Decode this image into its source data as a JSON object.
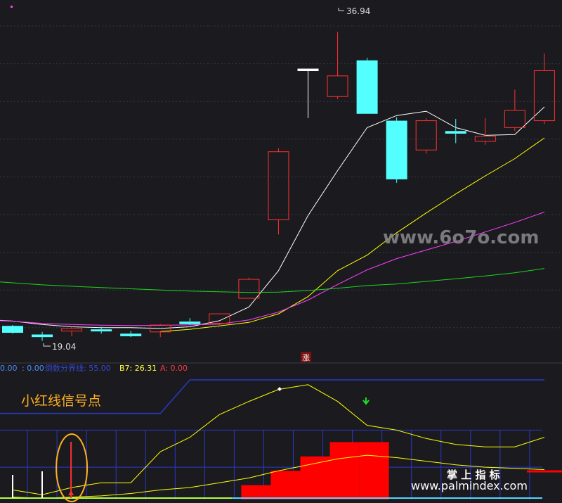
{
  "chart_data": [
    {
      "type": "candlestick",
      "panel": "main",
      "price_range": [
        18.4,
        38.8
      ],
      "annotations": {
        "high_label": "36.94",
        "low_label": "19.04",
        "zhang_badge": "涨"
      },
      "watermark": "www.6o7o.com",
      "candles": [
        {
          "open": 19.9,
          "close": 19.5,
          "high": 19.95,
          "low": 19.45
        },
        {
          "open": 19.4,
          "close": 19.25,
          "high": 19.55,
          "low": 19.04
        },
        {
          "open": 19.6,
          "close": 19.75,
          "high": 19.9,
          "low": 19.3
        },
        {
          "open": 19.7,
          "close": 19.58,
          "high": 19.85,
          "low": 19.45
        },
        {
          "open": 19.45,
          "close": 19.3,
          "high": 19.6,
          "low": 19.25
        },
        {
          "open": 19.55,
          "close": 19.95,
          "high": 20.0,
          "low": 19.25
        },
        {
          "open": 20.15,
          "close": 20.0,
          "high": 20.35,
          "low": 19.95
        },
        {
          "open": 20.05,
          "close": 20.6,
          "high": 20.6,
          "low": 19.95
        },
        {
          "open": 21.5,
          "close": 22.6,
          "high": 22.7,
          "low": 21.5
        },
        {
          "open": 26.05,
          "close": 30.0,
          "high": 30.2,
          "low": 25.2
        },
        {
          "open": 34.7,
          "close": 34.8,
          "high": 34.8,
          "low": 31.95
        },
        {
          "open": 33.2,
          "close": 34.4,
          "high": 36.94,
          "low": 33.05
        },
        {
          "open": 35.3,
          "close": 32.2,
          "high": 35.45,
          "low": 32.2
        },
        {
          "open": 31.8,
          "close": 28.4,
          "high": 32.0,
          "low": 28.2
        },
        {
          "open": 30.1,
          "close": 31.8,
          "high": 31.95,
          "low": 29.9
        },
        {
          "open": 31.2,
          "close": 31.05,
          "high": 31.9,
          "low": 30.5
        },
        {
          "open": 30.6,
          "close": 30.9,
          "high": 31.95,
          "low": 30.4
        },
        {
          "open": 31.4,
          "close": 32.4,
          "high": 33.6,
          "low": 31.2
        },
        {
          "open": 31.8,
          "close": 34.7,
          "high": 35.7,
          "low": 31.6
        }
      ],
      "moving_averages": [
        {
          "color": "#ffffff",
          "values": [
            20.18,
            19.98,
            19.85,
            19.8,
            19.8,
            19.75,
            19.85,
            20.2,
            21.0,
            23.1,
            26.3,
            28.9,
            31.4,
            32.1,
            32.35,
            31.4,
            30.95,
            31.0,
            32.6
          ]
        },
        {
          "color": "#ffff00",
          "values": [
            null,
            null,
            null,
            null,
            null,
            19.57,
            19.7,
            19.9,
            20.1,
            20.6,
            21.6,
            23.1,
            24.0,
            25.3,
            26.45,
            27.55,
            28.6,
            29.6,
            30.8
          ]
        },
        {
          "color": "#ff40ff",
          "values": [
            20.17,
            20.05,
            19.98,
            19.94,
            19.92,
            19.93,
            19.96,
            20.0,
            20.25,
            20.7,
            21.4,
            22.3,
            23.15,
            23.8,
            24.3,
            24.8,
            25.35,
            25.9,
            26.5
          ]
        },
        {
          "color": "#1fd41f",
          "values": [
            22.4,
            22.28,
            22.2,
            22.12,
            22.05,
            21.98,
            21.92,
            21.88,
            21.84,
            21.86,
            21.95,
            22.08,
            22.24,
            22.33,
            22.48,
            22.63,
            22.8,
            22.98,
            23.23
          ]
        }
      ]
    },
    {
      "type": "indicator",
      "panel": "sub",
      "legend": [
        {
          "text": "0.00",
          "color": "#4c8cff"
        },
        {
          "text": ": 0.00",
          "color": "#4c8cff"
        },
        {
          "text": "倒数分界线: 55.00",
          "color": "#3548d6"
        },
        {
          "text": "B7: 26.31",
          "color": "#ffff44"
        },
        {
          "text": "A: 0.00",
          "color": "#ff3b3b"
        }
      ],
      "caption": "小红线信号点",
      "brand": {
        "name": "掌 上 指 标",
        "url": "www.palmindex.com"
      },
      "range": [
        0,
        100
      ],
      "divider_level": 55,
      "blue_line": [
        72,
        72,
        72,
        72,
        72,
        72,
        100,
        100,
        100,
        100,
        100,
        100,
        100,
        100,
        100,
        100,
        100,
        100,
        100
      ],
      "b7_line": [
        8,
        4,
        10,
        14,
        14,
        40,
        52,
        71,
        82,
        92,
        96,
        82,
        62,
        58,
        51,
        46,
        44,
        44,
        52
      ],
      "b7_lower_line": [
        2,
        1,
        2,
        3,
        5,
        8,
        10,
        14,
        18,
        24,
        29,
        34,
        37,
        35,
        32,
        29,
        27,
        26,
        25
      ],
      "red_steps": [
        0,
        0,
        0,
        0,
        0,
        0,
        0,
        0,
        12,
        24,
        36,
        48,
        48,
        0,
        0,
        0,
        0,
        0,
        0
      ],
      "signal_index": 2
    }
  ]
}
